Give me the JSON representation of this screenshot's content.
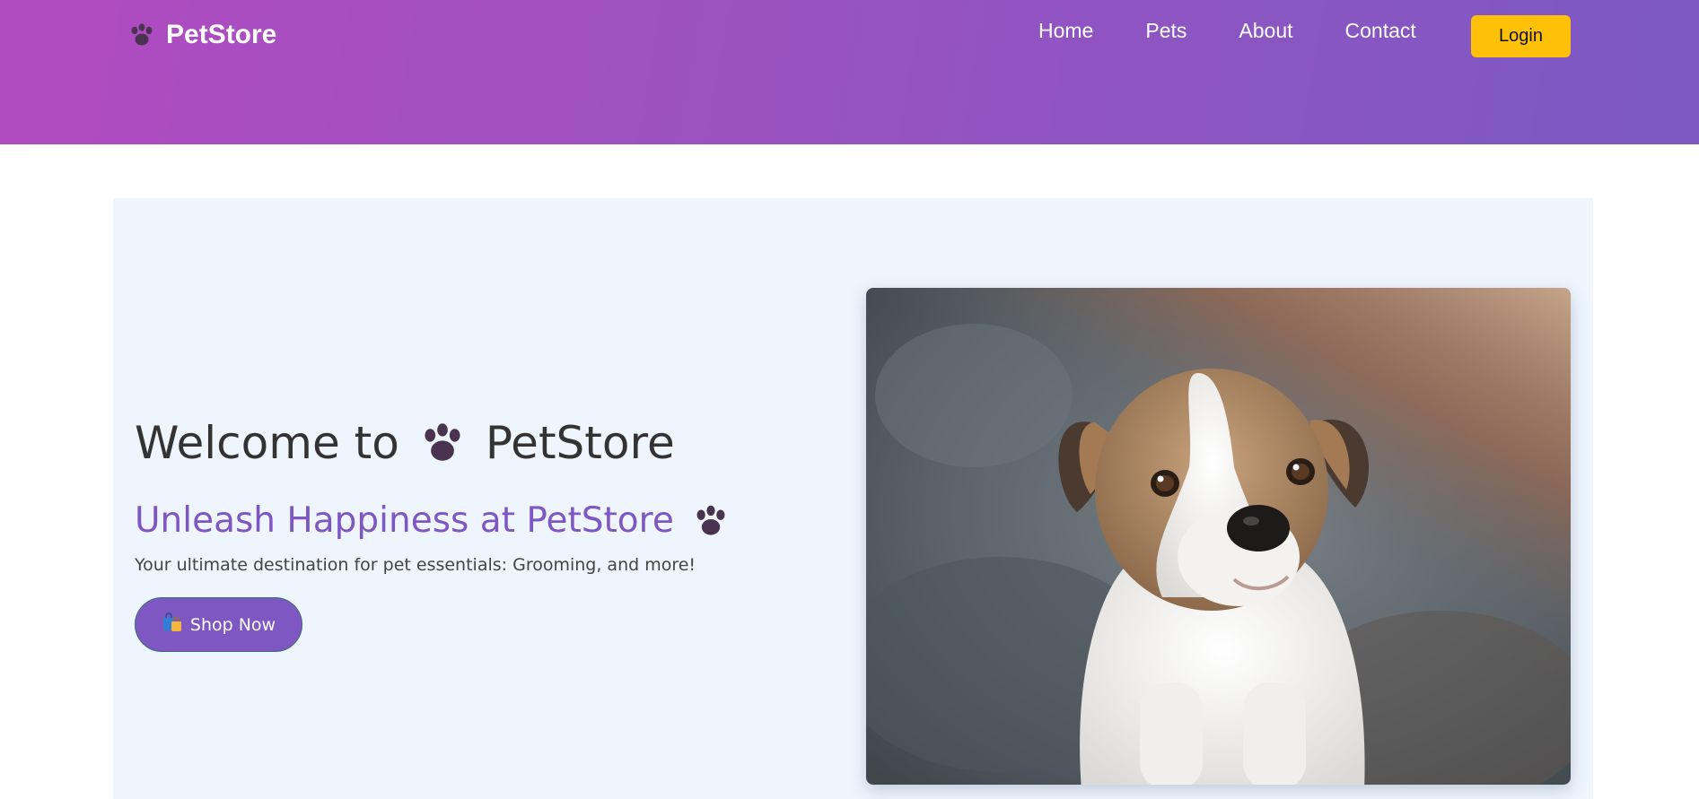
{
  "header": {
    "brand": "PetStore",
    "brand_icon": "paw-icon",
    "nav": [
      "Home",
      "Pets",
      "About",
      "Contact"
    ],
    "login_label": "Login",
    "gradient_colors": [
      "#b14bc0",
      "#7c59c3"
    ],
    "login_color": "#ffc107"
  },
  "hero": {
    "title_prefix": "Welcome to",
    "title_brand": "PetStore",
    "subtitle": "Unleash Happiness at PetStore",
    "description": "Your ultimate destination for pet essentials: Grooming, and more!",
    "cta_label": "Shop Now",
    "cta_icon": "shopping-bags-icon",
    "accent_color": "#7e57c2",
    "background_color": "#eef5fd",
    "image_subject": "puppy-photo"
  }
}
